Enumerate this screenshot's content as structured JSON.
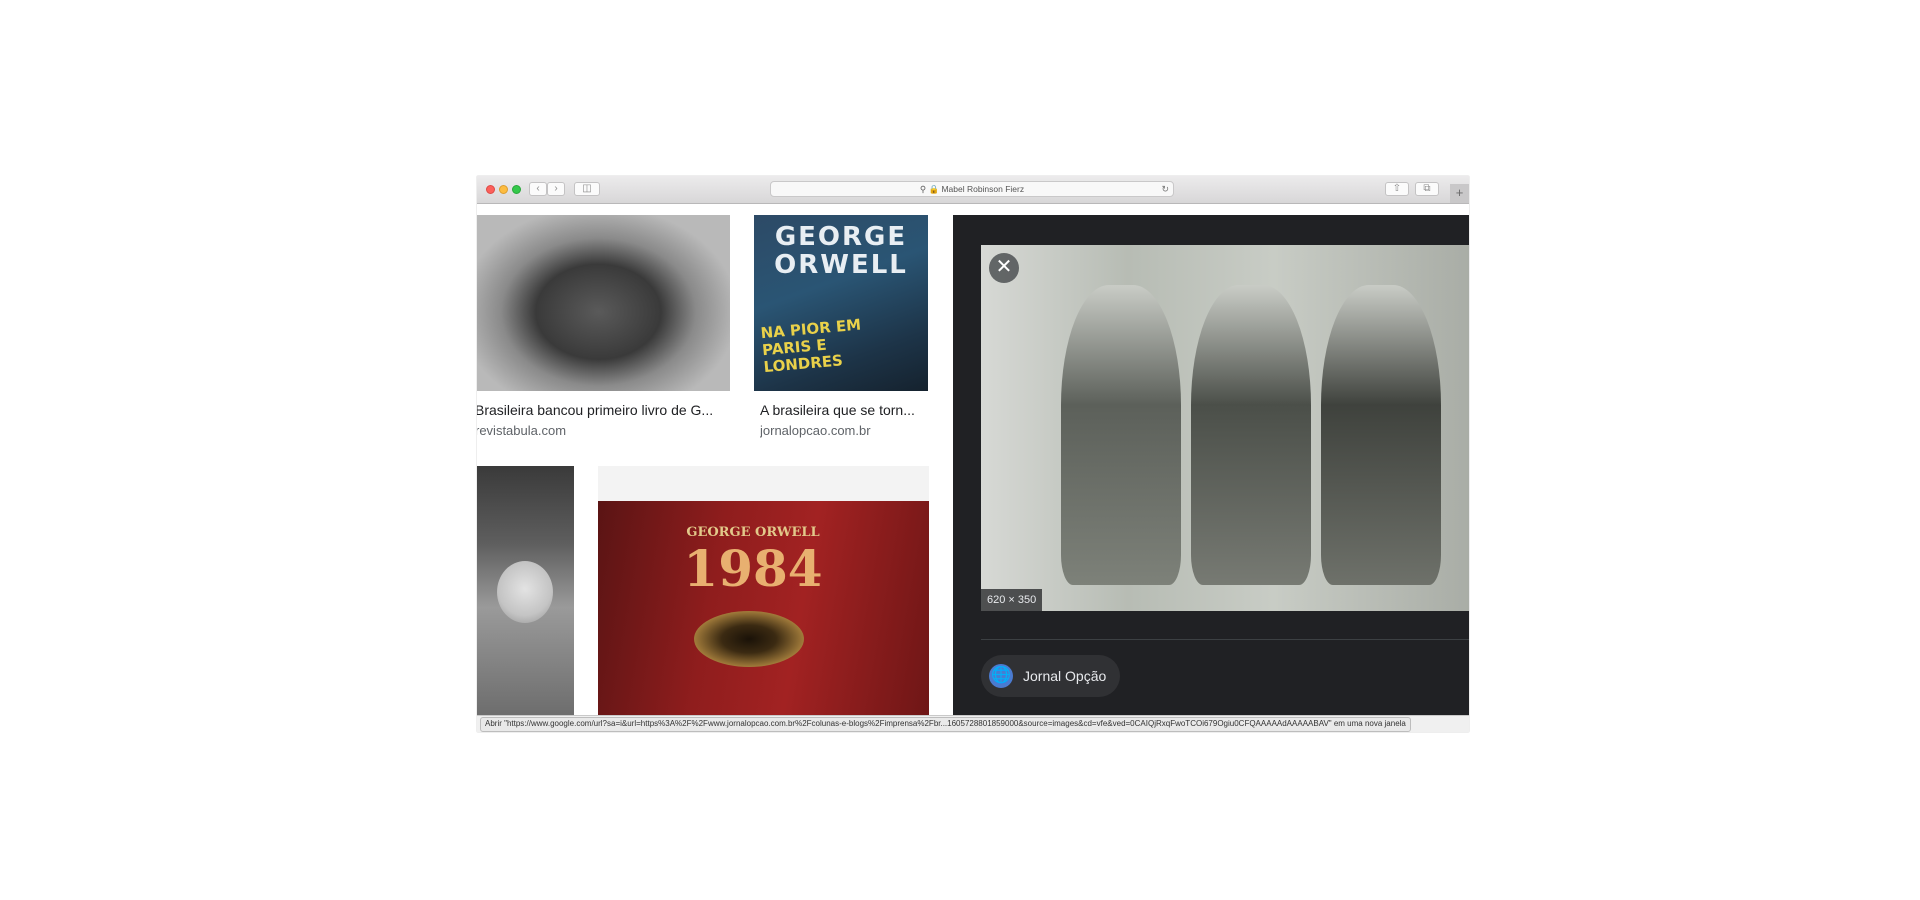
{
  "browser": {
    "address_bar_text": "Mabel Robinson Fierz",
    "status_bar_text": "Abrir \"https://www.google.com/url?sa=i&url=https%3A%2F%2Fwww.jornalopcao.com.br%2Fcolunas-e-blogs%2Fimprensa%2Fbr...1605728801859000&source=images&cd=vfe&ved=0CAIQjRxqFwoTCOi679Ogiu0CFQAAAAAdAAAAABAV\" em uma nova janela"
  },
  "results": [
    {
      "caption": "Brasileira bancou primeiro livro de G...",
      "source": "revistabula.com"
    },
    {
      "caption": "A brasileira que se torn...",
      "source": "jornalopcao.com.br"
    }
  ],
  "book_covers": {
    "orwell_paris_london": {
      "author": "GEORGE ORWELL",
      "title": "NA PIOR EM PARIS E LONDRES"
    },
    "orwell_1984": {
      "author": "GEORGE ORWELL",
      "title": "1984"
    }
  },
  "preview": {
    "dimensions": "620 × 350",
    "source_name": "Jornal Opção"
  },
  "colors": {
    "panel_background": "#202124",
    "chip_background": "#303134",
    "favicon_blue": "#4a7bd0"
  },
  "icons": [
    "close-icon",
    "globe-icon",
    "chevron-left-icon",
    "chevron-right-icon",
    "sidebar-icon",
    "lock-icon",
    "search-icon",
    "reload-icon",
    "share-icon",
    "tabs-icon",
    "plus-icon"
  ]
}
